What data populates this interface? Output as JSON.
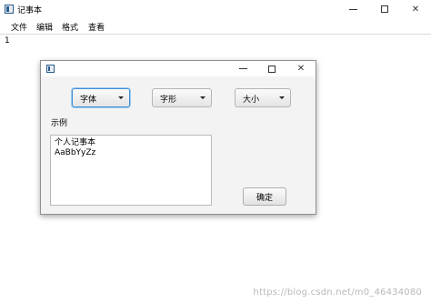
{
  "window": {
    "title": "记事本",
    "controls": {
      "minimize": "—",
      "maximize": "",
      "close": "✕"
    }
  },
  "menubar": {
    "items": [
      "文件",
      "编辑",
      "格式",
      "查看"
    ]
  },
  "editor": {
    "content": "1"
  },
  "dialog": {
    "controls": {
      "minimize": "—",
      "maximize": "",
      "close": "✕"
    },
    "combos": {
      "font": "字体",
      "style": "字形",
      "size": "大小"
    },
    "sample_label": "示例",
    "sample_lines": [
      "个人记事本",
      "AaBbYyZz"
    ],
    "ok_label": "确定"
  },
  "watermark": "https://blog.csdn.net/m0_46434080",
  "colors": {
    "focus_border": "#3d8fd6",
    "dialog_bg": "#f3f3f3"
  }
}
